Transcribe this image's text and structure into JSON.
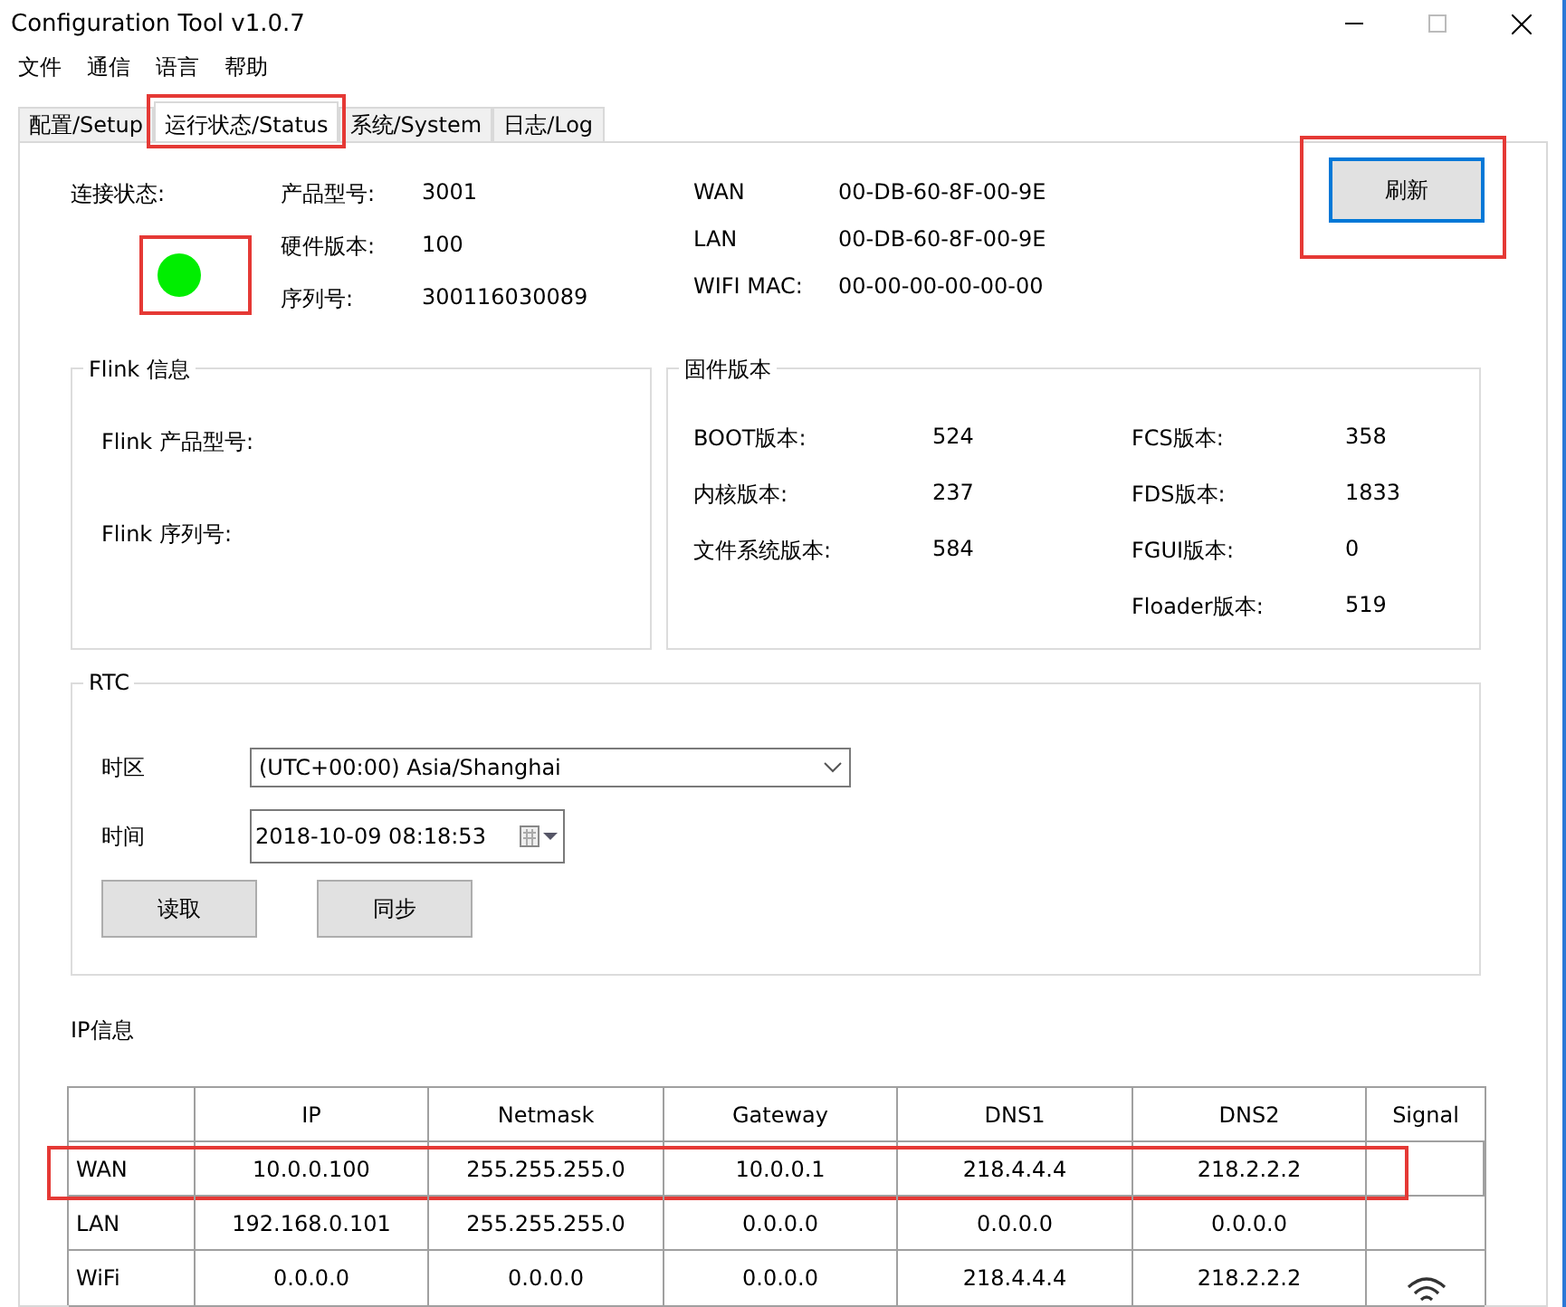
{
  "window": {
    "title": "Configuration Tool v1.0.7"
  },
  "menu": [
    "文件",
    "通信",
    "语言",
    "帮助"
  ],
  "tabs": [
    {
      "label": "配置/Setup",
      "selected": false,
      "highlighted": false
    },
    {
      "label": "运行状态/Status",
      "selected": true,
      "highlighted": true
    },
    {
      "label": "系统/System",
      "selected": false,
      "highlighted": false
    },
    {
      "label": "日志/Log",
      "selected": false,
      "highlighted": false
    }
  ],
  "connection": {
    "label": "连接状态:",
    "color": "#00ee00",
    "highlighted": true
  },
  "device_info": [
    {
      "label": "产品型号:",
      "value": "3001"
    },
    {
      "label": "硬件版本:",
      "value": "100"
    },
    {
      "label": "序列号:",
      "value": "300116030089"
    }
  ],
  "mac_info": [
    {
      "label": "WAN",
      "value": "00-DB-60-8F-00-9E"
    },
    {
      "label": "LAN",
      "value": "00-DB-60-8F-00-9E"
    },
    {
      "label": "WIFI MAC:",
      "value": "00-00-00-00-00-00"
    }
  ],
  "refresh_button": {
    "label": "刷新",
    "highlighted": true
  },
  "flink": {
    "title": "Flink 信息",
    "fields": [
      "Flink 产品型号:",
      "Flink 序列号:"
    ]
  },
  "firmware": {
    "title": "固件版本",
    "left": [
      {
        "label": "BOOT版本:",
        "value": "524"
      },
      {
        "label": "内核版本:",
        "value": "237"
      },
      {
        "label": "文件系统版本:",
        "value": "584"
      }
    ],
    "right": [
      {
        "label": "FCS版本:",
        "value": "358"
      },
      {
        "label": "FDS版本:",
        "value": "1833"
      },
      {
        "label": "FGUI版本:",
        "value": "0"
      },
      {
        "label": "Floader版本:",
        "value": "519"
      }
    ]
  },
  "rtc": {
    "title": "RTC",
    "timezone_label": "时区",
    "timezone": "(UTC+00:00) Asia/Shanghai",
    "time_label": "时间",
    "time": "2018-10-09 08:18:53",
    "buttons": [
      "读取",
      "同步"
    ]
  },
  "ip_info": {
    "title": "IP信息",
    "columns": [
      "",
      "IP",
      "Netmask",
      "Gateway",
      "DNS1",
      "DNS2",
      "Signal"
    ],
    "rows": [
      {
        "cells": [
          "WAN",
          "10.0.0.100",
          "255.255.255.0",
          "10.0.0.1",
          "218.4.4.4",
          "218.2.2.2"
        ],
        "wifi_signal": false,
        "highlighted": true
      },
      {
        "cells": [
          "LAN",
          "192.168.0.101",
          "255.255.255.0",
          "0.0.0.0",
          "0.0.0.0",
          "0.0.0.0"
        ],
        "wifi_signal": false,
        "highlighted": false
      },
      {
        "cells": [
          "WiFi",
          "0.0.0.0",
          "0.0.0.0",
          "0.0.0.0",
          "218.4.4.4",
          "218.2.2.2"
        ],
        "wifi_signal": true,
        "highlighted": false
      }
    ]
  }
}
